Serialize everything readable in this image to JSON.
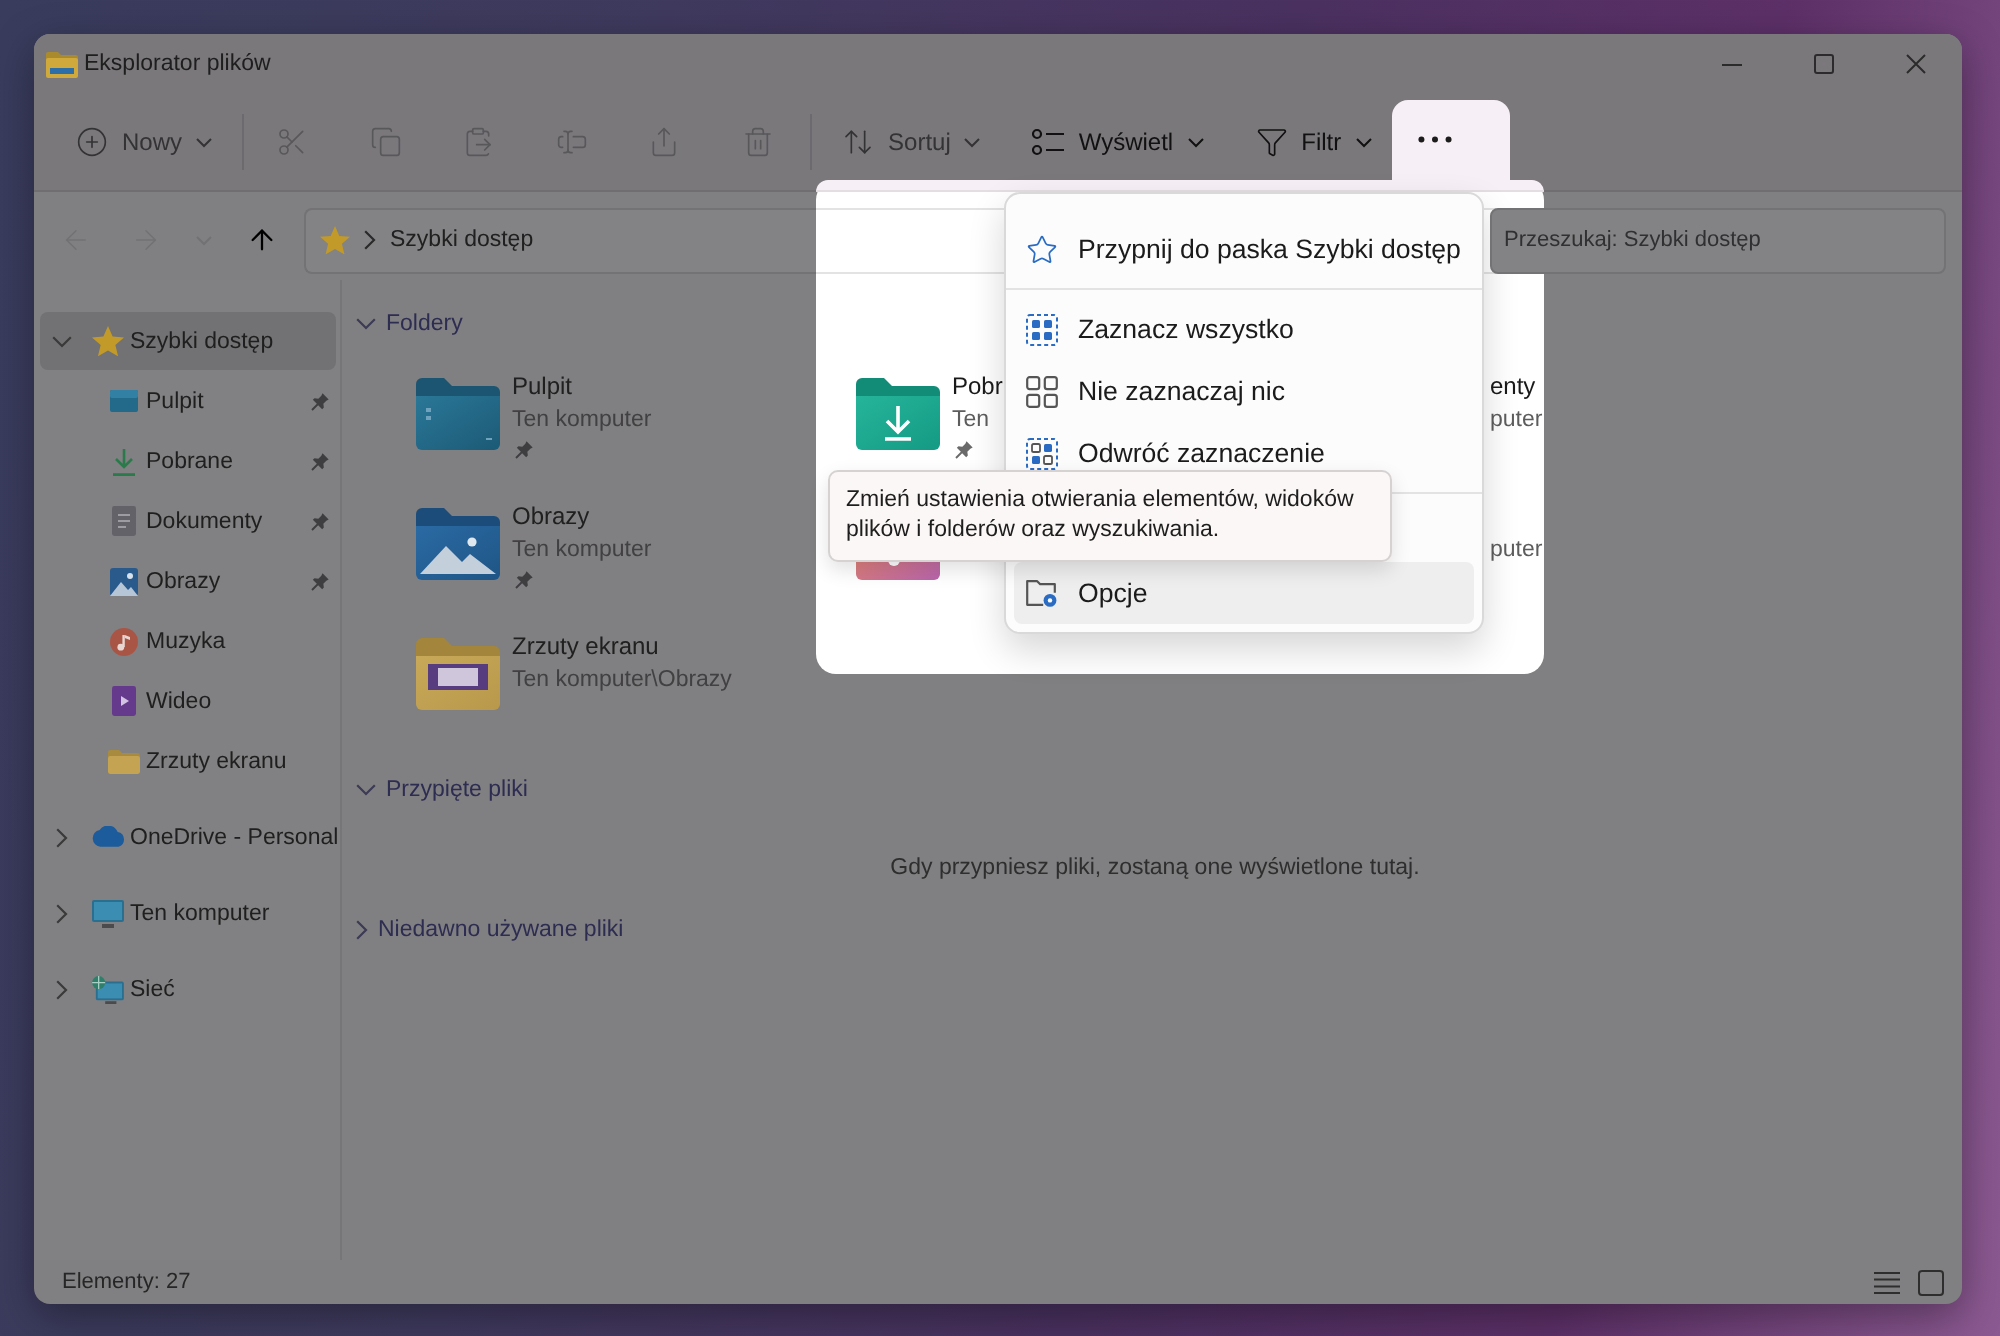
{
  "window": {
    "title": "Eksplorator plików"
  },
  "toolbar": {
    "items": [
      {
        "kind": "new",
        "label": "Nowy",
        "disabled": true
      },
      {
        "kind": "separator"
      },
      {
        "kind": "cut",
        "disabled": true
      },
      {
        "kind": "copy",
        "disabled": true
      },
      {
        "kind": "paste",
        "disabled": true
      },
      {
        "kind": "rename",
        "disabled": true
      },
      {
        "kind": "share",
        "disabled": true
      },
      {
        "kind": "delete",
        "disabled": true
      },
      {
        "kind": "separator"
      },
      {
        "kind": "sort",
        "label": "Sortuj",
        "disabled": true
      },
      {
        "kind": "view",
        "label": "Wyświetl",
        "disabled": false
      },
      {
        "kind": "filter",
        "label": "Filtr",
        "disabled": false
      }
    ]
  },
  "navigation": {
    "buttons": [
      {
        "kind": "back",
        "disabled": true
      },
      {
        "kind": "forward",
        "disabled": true
      },
      {
        "kind": "recent",
        "disabled": true
      },
      {
        "kind": "up",
        "disabled": false
      }
    ],
    "address": [
      "Szybki dostęp"
    ],
    "search": {
      "placeholder": "Przeszukaj: Szybki dostęp"
    }
  },
  "sidebar": {
    "items": [
      {
        "kind": "quick_access",
        "label": "Szybki dostęp",
        "selected": true,
        "expanded": true,
        "children": [
          {
            "kind": "desktop",
            "label": "Pulpit",
            "selected": false,
            "pinned": true
          },
          {
            "kind": "downloads",
            "label": "Pobrane",
            "selected": false,
            "pinned": true
          },
          {
            "kind": "documents",
            "label": "Dokumenty",
            "selected": false,
            "pinned": true
          },
          {
            "kind": "pictures",
            "label": "Obrazy",
            "selected": false,
            "pinned": true
          },
          {
            "kind": "music",
            "label": "Muzyka",
            "selected": false,
            "pinned": false
          },
          {
            "kind": "videos",
            "label": "Wideo",
            "selected": false,
            "pinned": false
          },
          {
            "kind": "folder",
            "label": "Zrzuty ekranu",
            "selected": false,
            "pinned": false
          }
        ]
      },
      {
        "kind": "cloud",
        "label": "OneDrive - Personal",
        "selected": false,
        "expanded": false
      },
      {
        "kind": "computer",
        "label": "Ten komputer",
        "selected": false,
        "expanded": false
      },
      {
        "kind": "network",
        "label": "Sieć",
        "selected": false,
        "expanded": false
      }
    ]
  },
  "content": {
    "sections": [
      {
        "title": "Foldery",
        "expanded": true,
        "folders": [
          {
            "kind": "desktop",
            "name": "Pulpit",
            "location": "Ten komputer",
            "pinned": true
          },
          {
            "kind": "pictures",
            "name": "Obrazy",
            "location": "Ten komputer",
            "pinned": true
          },
          {
            "kind": "screenshots",
            "name": "Zrzuty ekranu",
            "location": "Ten komputer\\Obrazy",
            "pinned": false
          }
        ]
      },
      {
        "title": "Przypięte pliki",
        "expanded": true,
        "empty_message": "Gdy przypniesz pliki, zostaną one wyświetlone tutaj."
      },
      {
        "title": "Niedawno używane pliki",
        "expanded": false
      }
    ]
  },
  "spotlight": {
    "folders": [
      {
        "kind": "downloads",
        "name": "Pobr",
        "location": "Ten",
        "pinned": true
      },
      {
        "kind": "music"
      }
    ],
    "right_column": [
      {
        "name": "enty",
        "location": "puter"
      },
      {
        "location": "puter"
      }
    ]
  },
  "more_menu": {
    "open": true,
    "items": [
      {
        "kind": "pin",
        "label": "Przypnij do paska Szybki dostęp",
        "highlighted": false
      },
      {
        "kind": "separator"
      },
      {
        "kind": "select_all",
        "label": "Zaznacz wszystko",
        "highlighted": false
      },
      {
        "kind": "select_none",
        "label": "Nie zaznaczaj nic",
        "highlighted": false
      },
      {
        "kind": "invert",
        "label": "Odwróć zaznaczenie",
        "highlighted": false
      },
      {
        "kind": "separator"
      },
      {
        "kind": "options",
        "label": "Opcje",
        "highlighted": true
      }
    ],
    "tooltip": "Zmień ustawienia otwierania elementów, widoków plików i folderów oraz wyszukiwania."
  },
  "status_bar": {
    "count": "Elementy: 27",
    "views": [
      {
        "kind": "details"
      },
      {
        "kind": "tiles"
      }
    ]
  }
}
